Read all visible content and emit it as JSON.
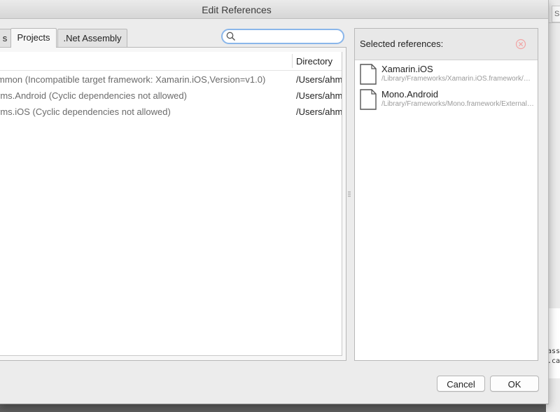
{
  "dialog": {
    "title": "Edit References"
  },
  "tabs": [
    {
      "label": "s"
    },
    {
      "label": "Projects",
      "active": true
    },
    {
      "label": ".Net Assembly"
    }
  ],
  "search": {
    "value": "",
    "placeholder": ""
  },
  "projects_list": {
    "columns": {
      "directory": "Directory"
    },
    "rows": [
      {
        "name": "mmon (Incompatible target framework: Xamarin.iOS,Version=v1.0)",
        "directory": "/Users/ahm"
      },
      {
        "name": "rms.Android (Cyclic dependencies not allowed)",
        "directory": "/Users/ahm"
      },
      {
        "name": "rms.iOS (Cyclic dependencies not allowed)",
        "directory": "/Users/ahm"
      }
    ]
  },
  "selected_references": {
    "title": "Selected references:",
    "items": [
      {
        "name": "Xamarin.iOS",
        "path": "/Library/Frameworks/Xamarin.iOS.framework/Versions/Current"
      },
      {
        "name": "Mono.Android",
        "path": "/Library/Frameworks/Mono.framework/External/xbuild-frameworks"
      }
    ]
  },
  "buttons": {
    "cancel": "Cancel",
    "ok": "OK"
  },
  "background": {
    "tab_label": "Si",
    "code_lines": [
      "ass",
      ".ca"
    ]
  },
  "colors": {
    "search_focus": "#8ab6ea",
    "clear_icon": "#f2a4a4",
    "disabled_text": "#6b6b6b"
  }
}
